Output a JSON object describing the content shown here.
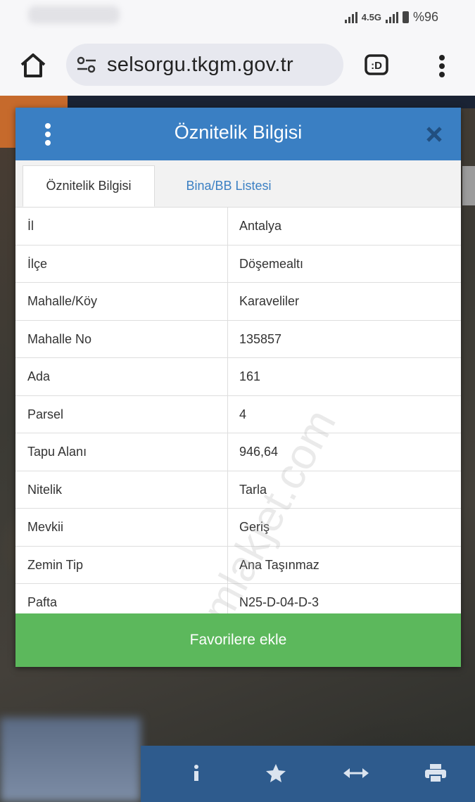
{
  "status_bar": {
    "network": "4.5G",
    "battery": "%96"
  },
  "browser": {
    "url": "selsorgu.tkgm.gov.tr",
    "home_icon": "home-icon",
    "site_settings_icon": "tune-icon",
    "tabs_icon": "tab-switcher-icon",
    "menu_icon": "more-vert-icon"
  },
  "dialog": {
    "title": "Öznitelik Bilgisi",
    "tabs": [
      {
        "label": "Öznitelik Bilgisi",
        "active": true
      },
      {
        "label": "Bina/BB Listesi",
        "active": false
      }
    ],
    "rows": [
      {
        "key": "İl",
        "value": "Antalya"
      },
      {
        "key": "İlçe",
        "value": "Döşemealtı"
      },
      {
        "key": "Mahalle/Köy",
        "value": "Karaveliler"
      },
      {
        "key": "Mahalle No",
        "value": "135857"
      },
      {
        "key": "Ada",
        "value": "161"
      },
      {
        "key": "Parsel",
        "value": "4"
      },
      {
        "key": "Tapu Alanı",
        "value": "946,64"
      },
      {
        "key": "Nitelik",
        "value": "Tarla"
      },
      {
        "key": "Mevkii",
        "value": "Geriş"
      },
      {
        "key": "Zemin Tip",
        "value": "Ana Taşınmaz"
      },
      {
        "key": "Pafta",
        "value": "N25-D-04-D-3"
      }
    ],
    "favorite_button": "Favorilere ekle",
    "watermark": "emlakjet.com"
  },
  "bottom_toolbar": {
    "icons": [
      "info-icon",
      "star-icon",
      "measure-icon",
      "print-icon"
    ]
  },
  "colors": {
    "header_blue": "#3a7fc3",
    "favorite_green": "#5cb85c",
    "toolbar_blue": "#2e5b8d"
  }
}
